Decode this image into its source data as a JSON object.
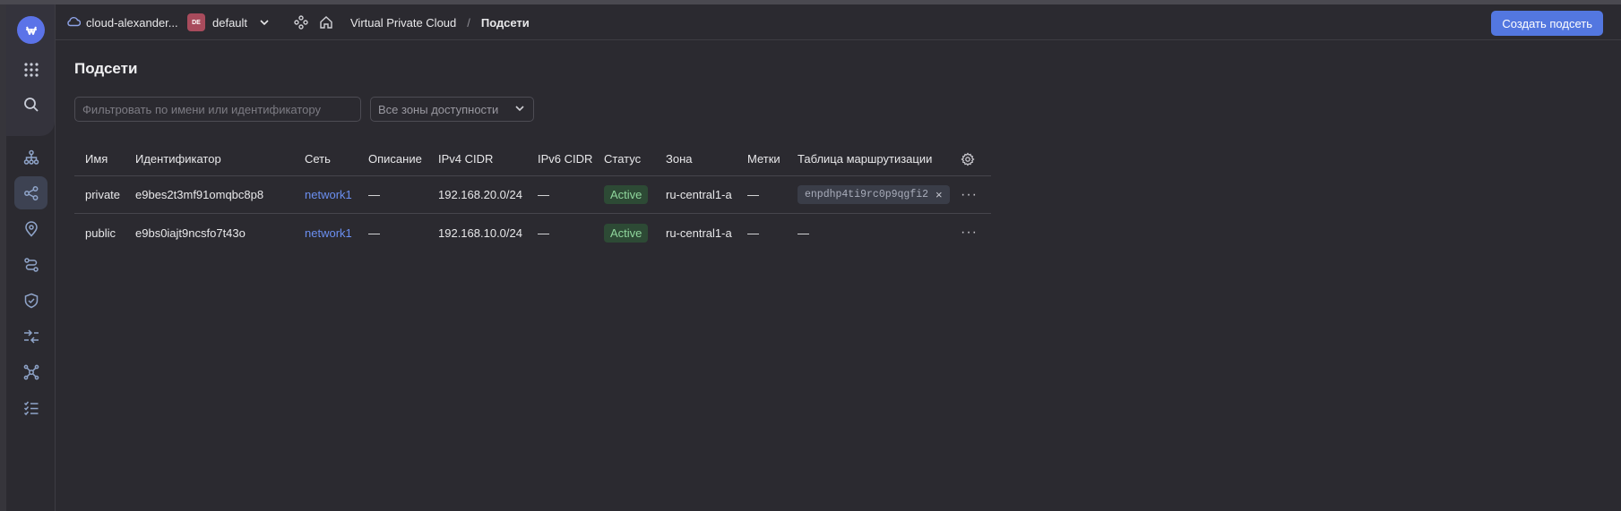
{
  "header": {
    "cloud_name": "cloud-alexander...",
    "folder_badge": "DE",
    "folder_name": "default",
    "breadcrumb_service": "Virtual Private Cloud",
    "breadcrumb_separator": "/",
    "breadcrumb_current": "Подсети",
    "create_button_label": "Создать подсеть"
  },
  "page": {
    "title": "Подсети",
    "filter_placeholder": "Фильтровать по имени или идентификатору",
    "zone_select_value": "Все зоны доступности"
  },
  "table": {
    "columns": [
      "Имя",
      "Идентификатор",
      "Сеть",
      "Описание",
      "IPv4 CIDR",
      "IPv6 CIDR",
      "Статус",
      "Зона",
      "Метки",
      "Таблица маршрутизации"
    ],
    "rows": [
      {
        "name": "private",
        "id": "e9bes2t3mf91omqbc8p8",
        "network": "network1",
        "description": "—",
        "ipv4": "192.168.20.0/24",
        "ipv6": "—",
        "status": "Active",
        "zone": "ru-central1-a",
        "labels": "—",
        "route_table": "enpdhp4ti9rc0p9qgfi2",
        "route_table_remove": "×",
        "menu": "···"
      },
      {
        "name": "public",
        "id": "e9bs0iajt9ncsfo7t43o",
        "network": "network1",
        "description": "—",
        "ipv4": "192.168.10.0/24",
        "ipv6": "—",
        "status": "Active",
        "zone": "ru-central1-a",
        "labels": "—",
        "route_table": "—",
        "menu": "···"
      }
    ]
  },
  "sidebar": {
    "icons": [
      "logo-icon",
      "services-grid-icon",
      "search-icon",
      "cloud-networks-icon",
      "subnets-icon",
      "ip-addresses-icon",
      "route-tables-icon",
      "security-groups-icon",
      "gateways-icon",
      "private-endpoints-icon",
      "operations-icon"
    ]
  },
  "colors": {
    "accent": "#5377e0",
    "background": "#2b2a30",
    "status_active_bg": "#2d4a35",
    "status_active_text": "#8fd69c",
    "folder_badge": "#a84b5c"
  }
}
